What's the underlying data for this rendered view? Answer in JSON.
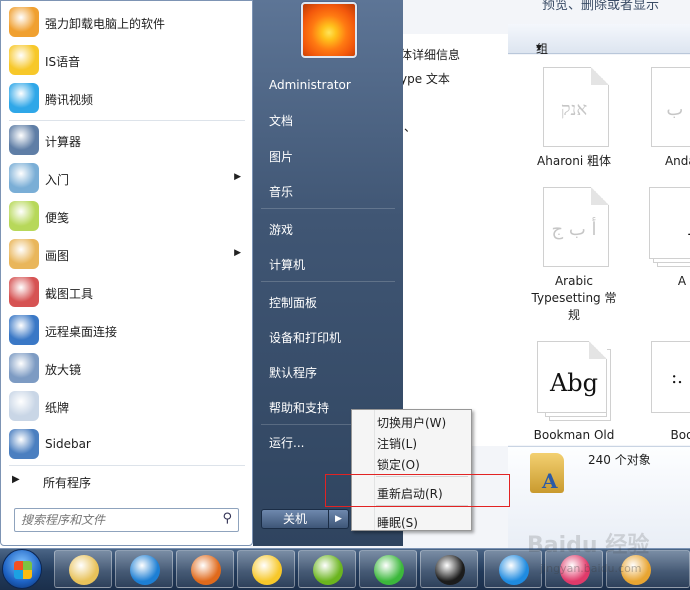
{
  "background_window": {
    "top_text": "预览、删除或者显示",
    "left_lines": [
      "体详细信息",
      "ype 文本",
      "、"
    ],
    "toolbar_label": "组织",
    "font_tiles": [
      {
        "label": "Aharoni 粗体",
        "glyph": "אנק"
      },
      {
        "label": "Andal",
        "glyph": "ء ب"
      },
      {
        "label": "Arabic Typesetting 常规",
        "glyph": "أ ب ج"
      },
      {
        "label": "A",
        "glyph": "A"
      },
      {
        "label": "Bookman Old",
        "glyph": "Abg"
      },
      {
        "label": "Boo",
        "glyph": ":."
      }
    ],
    "status_text": "240 个对象"
  },
  "start_menu": {
    "programs": [
      {
        "label": "强力卸载电脑上的软件",
        "icon": "uninstaller-icon",
        "color": "#f0a030",
        "arrow": false
      },
      {
        "label": "IS语音",
        "icon": "is-voice-icon",
        "color": "#f7c82a",
        "arrow": false
      },
      {
        "label": "腾讯视频",
        "icon": "tencent-video-icon",
        "color": "#2fa7e8",
        "arrow": false
      },
      {
        "label": "计算器",
        "icon": "calculator-icon",
        "color": "#5f7ea6",
        "arrow": false
      },
      {
        "label": "入门",
        "icon": "getting-started-icon",
        "color": "#7aaed6",
        "arrow": true
      },
      {
        "label": "便笺",
        "icon": "sticky-notes-icon",
        "color": "#b7d85a",
        "arrow": false
      },
      {
        "label": "画图",
        "icon": "paint-icon",
        "color": "#e9b65b",
        "arrow": true
      },
      {
        "label": "截图工具",
        "icon": "snipping-tool-icon",
        "color": "#d65353",
        "arrow": false
      },
      {
        "label": "远程桌面连接",
        "icon": "remote-desktop-icon",
        "color": "#3a78c6",
        "arrow": false
      },
      {
        "label": "放大镜",
        "icon": "magnifier-icon",
        "color": "#7d9bc3",
        "arrow": false
      },
      {
        "label": "纸牌",
        "icon": "solitaire-icon",
        "color": "#c9d6e6",
        "arrow": false
      },
      {
        "label": "Sidebar",
        "icon": "sidebar-icon",
        "color": "#4b7fc0",
        "arrow": false
      }
    ],
    "all_programs": "所有程序",
    "search_placeholder": "搜索程序和文件",
    "user_name": "Administrator",
    "right_items": [
      "文档",
      "图片",
      "音乐",
      "游戏",
      "计算机",
      "控制面板",
      "设备和打印机",
      "默认程序",
      "帮助和支持",
      "运行..."
    ],
    "shutdown_label": "关机"
  },
  "shutdown_menu": {
    "items": [
      "切换用户(W)",
      "注销(L)",
      "锁定(O)",
      "重新启动(R)",
      "睡眠(S)"
    ]
  },
  "taskbar": {
    "buttons": [
      {
        "icon": "explorer-icon",
        "color": "#e8c25a"
      },
      {
        "icon": "kugou-icon",
        "color": "#1d7fd4"
      },
      {
        "icon": "firefox-icon",
        "color": "#e06a1c"
      },
      {
        "icon": "is-voice-icon",
        "color": "#f7c82a"
      },
      {
        "icon": "dreamweaver-icon",
        "color": "#6bb51f"
      },
      {
        "icon": "add-green-icon",
        "color": "#3cb83c"
      },
      {
        "icon": "qq-icon",
        "color": "#1c1c1c"
      },
      {
        "icon": "qt-icon",
        "color": "#1f8be0"
      },
      {
        "icon": "music-icon",
        "color": "#e03a6a"
      },
      {
        "icon": "game-icon",
        "color": "#e8a532"
      }
    ],
    "watermark": "Baidu 经验",
    "watermark_url": "jingyan.baidu.com"
  }
}
